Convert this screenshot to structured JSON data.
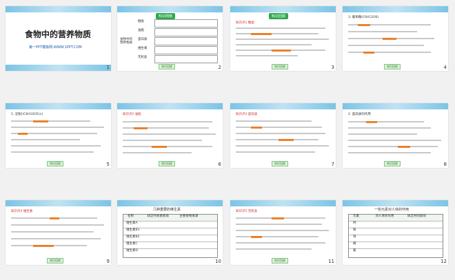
{
  "slides": [
    {
      "n": "1",
      "title": "食物中的营养物质",
      "subtitle": "第一PPT模板网-WWW.1PPT.COM"
    },
    {
      "n": "2",
      "badge": "知识网络",
      "center": "食物中的营养物质",
      "branches": [
        "糖类",
        "油脂",
        "蛋白质",
        "维生素",
        "无机盐"
      ],
      "button": "知识回顾"
    },
    {
      "n": "3",
      "badge": "知识回顾",
      "tag": "知识点1  糖类",
      "button": "知识回顾"
    },
    {
      "n": "4",
      "head": "3. 葡萄糖(C6H12O6)",
      "button": "知识回顾"
    },
    {
      "n": "5",
      "head": "5. 淀粉[(C6H10O5)n]",
      "button": "知识回顾"
    },
    {
      "n": "6",
      "tag": "知识点2  油脂",
      "button": "知识回顾"
    },
    {
      "n": "7",
      "tag": "知识点3  蛋白质",
      "button": "知识回顾"
    },
    {
      "n": "8",
      "head": "2. 蛋白质的作用",
      "button": "知识回顾"
    },
    {
      "n": "9",
      "tag": "知识点4  维生素",
      "button": "知识回顾"
    },
    {
      "n": "10",
      "title": "几种重要的维生素",
      "cols": [
        "名称",
        "缺乏时易患疾病",
        "主要食物来源"
      ],
      "rows": [
        "维生素A",
        "维生素B1",
        "维生素B2",
        "维生素C",
        "维生素D"
      ]
    },
    {
      "n": "11",
      "tag": "知识点5  无机盐",
      "button": "知识回顾"
    },
    {
      "n": "12",
      "title": "一些元素对人体的作用",
      "cols": [
        "元素",
        "对人体的作用",
        "缺乏时的影响"
      ],
      "rows": [
        "钙",
        "铁",
        "锌",
        "碘",
        "氟"
      ]
    }
  ]
}
